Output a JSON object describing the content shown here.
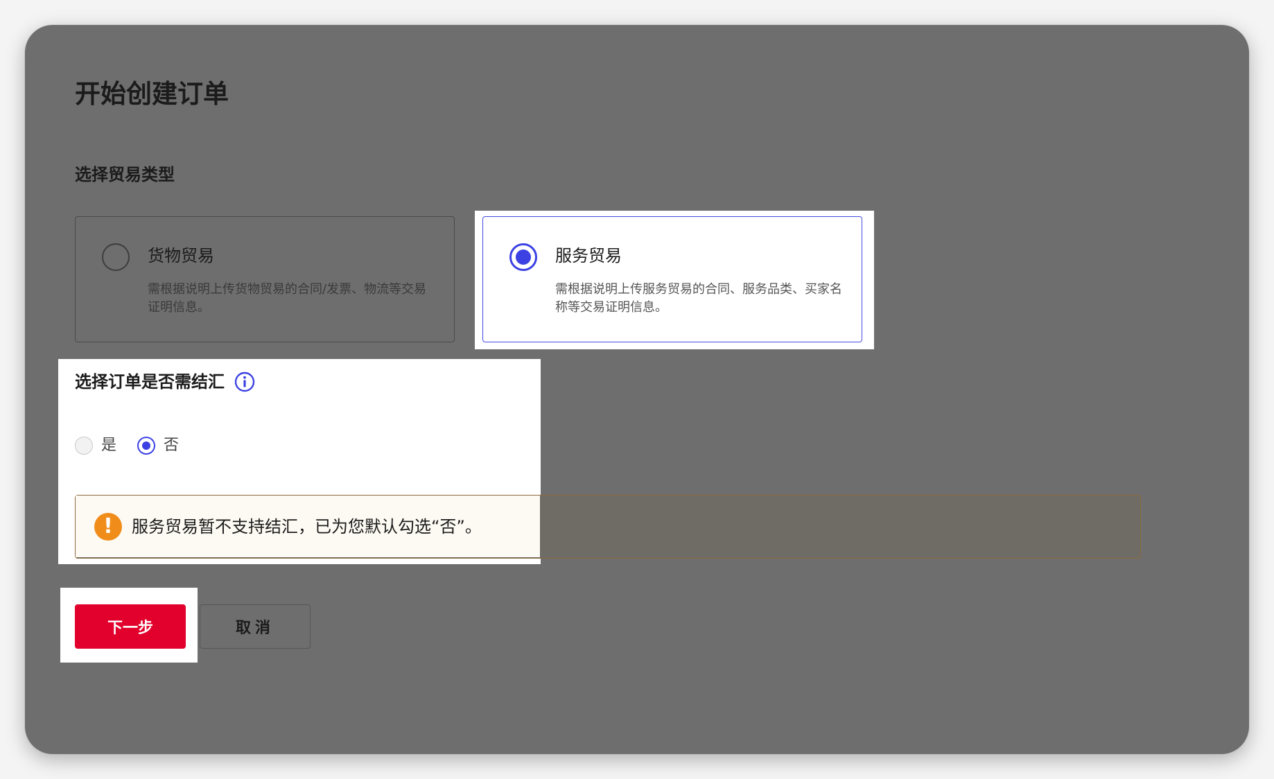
{
  "page": {
    "title": "开始创建订单"
  },
  "trade_type": {
    "section_title": "选择贸易类型",
    "options": [
      {
        "title": "货物贸易",
        "description": "需根据说明上传货物贸易的合同/发票、物流等交易证明信息。",
        "selected": false
      },
      {
        "title": "服务贸易",
        "description": "需根据说明上传服务贸易的合同、服务品类、买家名称等交易证明信息。",
        "selected": true
      }
    ]
  },
  "settlement": {
    "section_title": "选择订单是否需结汇",
    "info_icon": "info-circle-icon",
    "options": [
      {
        "label": "是",
        "selected": false,
        "disabled": true
      },
      {
        "label": "否",
        "selected": true,
        "disabled": false
      }
    ]
  },
  "warning": {
    "icon": "exclamation-circle-icon",
    "text": "服务贸易暂不支持结汇，已为您默认勾选“否”。"
  },
  "actions": {
    "next_label": "下一步",
    "cancel_label": "取消"
  },
  "colors": {
    "overlay": "#6e6e6e",
    "accent": "#3b41e3",
    "primary_button": "#e2002c",
    "warning_icon": "#f08d1a",
    "warning_bg": "#fdfaf3"
  }
}
